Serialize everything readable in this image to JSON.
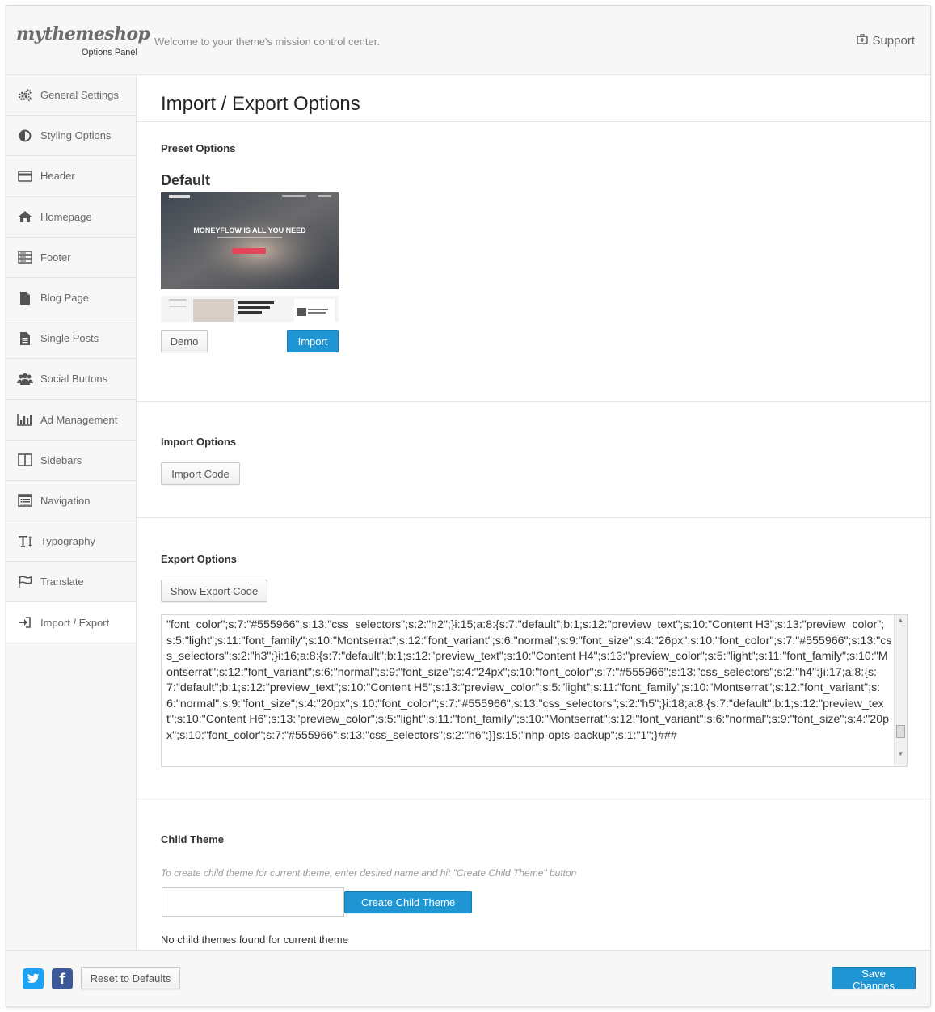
{
  "header": {
    "logo_text": "mythemeshop",
    "logo_sub": "Options Panel",
    "welcome": "Welcome to your theme's mission control center.",
    "support_label": "Support"
  },
  "sidebar": {
    "items": [
      {
        "label": "General Settings",
        "icon": "gears-icon"
      },
      {
        "label": "Styling Options",
        "icon": "contrast-icon"
      },
      {
        "label": "Header",
        "icon": "credit-card-icon"
      },
      {
        "label": "Homepage",
        "icon": "home-icon"
      },
      {
        "label": "Footer",
        "icon": "server-icon"
      },
      {
        "label": "Blog Page",
        "icon": "file-icon"
      },
      {
        "label": "Single Posts",
        "icon": "file-text-icon"
      },
      {
        "label": "Social Buttons",
        "icon": "users-icon"
      },
      {
        "label": "Ad Management",
        "icon": "bar-chart-icon"
      },
      {
        "label": "Sidebars",
        "icon": "columns-icon"
      },
      {
        "label": "Navigation",
        "icon": "list-alt-icon"
      },
      {
        "label": "Typography",
        "icon": "text-height-icon"
      },
      {
        "label": "Translate",
        "icon": "flag-icon"
      },
      {
        "label": "Import / Export",
        "icon": "sign-in-icon"
      }
    ],
    "active_index": 13
  },
  "main": {
    "title": "Import / Export Options",
    "preset": {
      "section_label": "Preset Options",
      "name": "Default",
      "image_headline": "MONEYFLOW IS ALL YOU NEED",
      "demo_label": "Demo",
      "import_label": "Import"
    },
    "import_options": {
      "section_label": "Import Options",
      "button_label": "Import Code"
    },
    "export_options": {
      "section_label": "Export Options",
      "button_label": "Show Export Code",
      "code_text": "\"font_color\";s:7:\"#555966\";s:13:\"css_selectors\";s:2:\"h2\";}i:15;a:8:{s:7:\"default\";b:1;s:12:\"preview_text\";s:10:\"Content H3\";s:13:\"preview_color\";s:5:\"light\";s:11:\"font_family\";s:10:\"Montserrat\";s:12:\"font_variant\";s:6:\"normal\";s:9:\"font_size\";s:4:\"26px\";s:10:\"font_color\";s:7:\"#555966\";s:13:\"css_selectors\";s:2:\"h3\";}i:16;a:8:{s:7:\"default\";b:1;s:12:\"preview_text\";s:10:\"Content H4\";s:13:\"preview_color\";s:5:\"light\";s:11:\"font_family\";s:10:\"Montserrat\";s:12:\"font_variant\";s:6:\"normal\";s:9:\"font_size\";s:4:\"24px\";s:10:\"font_color\";s:7:\"#555966\";s:13:\"css_selectors\";s:2:\"h4\";}i:17;a:8:{s:7:\"default\";b:1;s:12:\"preview_text\";s:10:\"Content H5\";s:13:\"preview_color\";s:5:\"light\";s:11:\"font_family\";s:10:\"Montserrat\";s:12:\"font_variant\";s:6:\"normal\";s:9:\"font_size\";s:4:\"20px\";s:10:\"font_color\";s:7:\"#555966\";s:13:\"css_selectors\";s:2:\"h5\";}i:18;a:8:{s:7:\"default\";b:1;s:12:\"preview_text\";s:10:\"Content H6\";s:13:\"preview_color\";s:5:\"light\";s:11:\"font_family\";s:10:\"Montserrat\";s:12:\"font_variant\";s:6:\"normal\";s:9:\"font_size\";s:4:\"20px\";s:10:\"font_color\";s:7:\"#555966\";s:13:\"css_selectors\";s:2:\"h6\";}}s:15:\"nhp-opts-backup\";s:1:\"1\";}###"
    },
    "child_theme": {
      "section_label": "Child Theme",
      "hint": "To create child theme for current theme, enter desired name and hit \"Create Child Theme\" button",
      "input_value": "",
      "button_label": "Create Child Theme",
      "status": "No child themes found for current theme"
    }
  },
  "footer": {
    "twitter_icon": "twitter-icon",
    "facebook_icon": "facebook-icon",
    "reset_label": "Reset to Defaults",
    "save_label": "Save Changes"
  },
  "colors": {
    "accent": "#1f96d3",
    "text": "#555966",
    "panel_bg": "#f7f7f7"
  }
}
